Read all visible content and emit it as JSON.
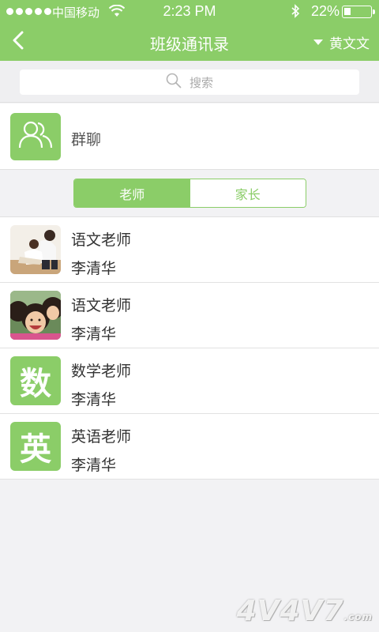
{
  "status_bar": {
    "carrier": "中国移动",
    "time": "2:23 PM",
    "battery": "22%"
  },
  "nav": {
    "title": "班级通讯录",
    "user": "黄文文",
    "back_icon": "chevron-left-icon"
  },
  "search": {
    "placeholder": "搜索",
    "icon": "search-icon"
  },
  "group_chat": {
    "label": "群聊",
    "icon": "users-icon"
  },
  "segments": [
    {
      "label": "老师",
      "active": true
    },
    {
      "label": "家长",
      "active": false
    }
  ],
  "contacts": [
    {
      "role": "语文老师",
      "name": "李清华",
      "avatar": "photo-mother-child"
    },
    {
      "role": "语文老师",
      "name": "李清华",
      "avatar": "photo-children"
    },
    {
      "role": "数学老师",
      "name": "李清华",
      "avatar_text": "数"
    },
    {
      "role": "英语老师",
      "name": "李清华",
      "avatar_text": "英"
    }
  ],
  "watermark": {
    "text": "4V4V7",
    "suffix": ".com"
  },
  "colors": {
    "accent": "#8bcd68",
    "background": "#f2f2f4"
  }
}
